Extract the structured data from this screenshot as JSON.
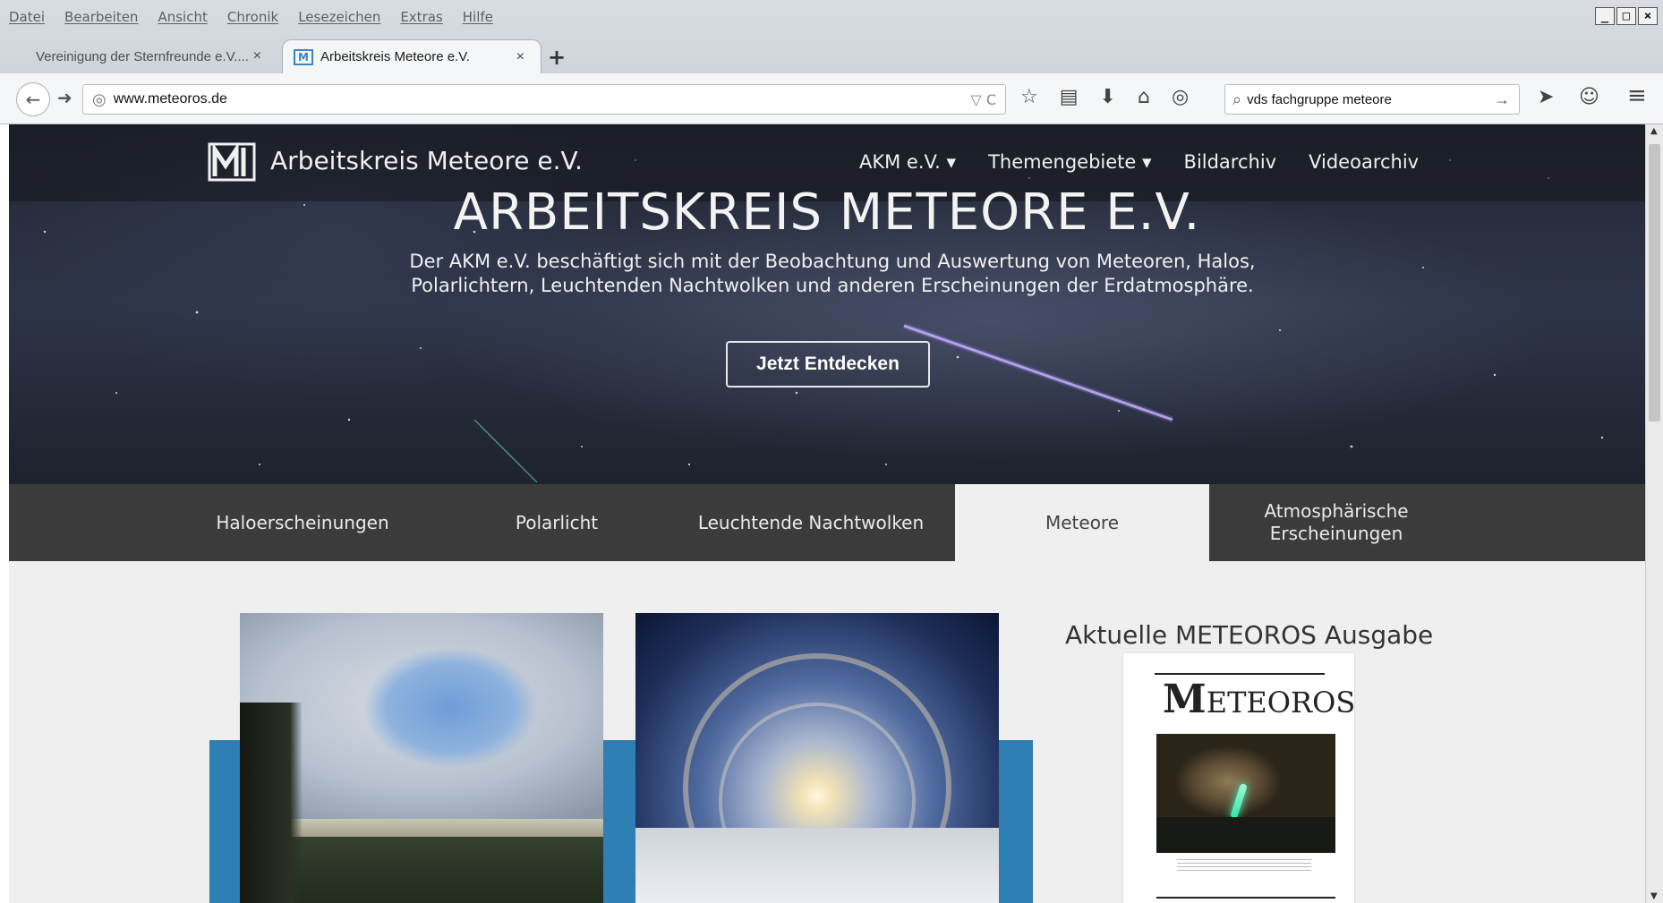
{
  "menubar": [
    "Datei",
    "Bearbeiten",
    "Ansicht",
    "Chronik",
    "Lesezeichen",
    "Extras",
    "Hilfe"
  ],
  "window_controls": [
    "_",
    "□",
    "×"
  ],
  "tabs": [
    {
      "label": "Vereinigung der Sternfreunde e.V....",
      "close": "×"
    },
    {
      "label": "Arbeitskreis Meteore e.V.",
      "close": "×",
      "favicon": "M"
    }
  ],
  "new_tab": "+",
  "address_bar": {
    "url": "www.meteoros.de",
    "right": "▽ C"
  },
  "search_bar": {
    "value": "vds fachgruppe meteore"
  },
  "toolbar_icons": [
    "☆",
    "▤",
    "⬇",
    "⌂",
    "◎"
  ],
  "toolbar_right": [
    "➤",
    "☺",
    "≡"
  ],
  "site": {
    "name": "Arbeitskreis Meteore e.V.",
    "nav": [
      "AKM e.V. ▾",
      "Themengebiete ▾",
      "Bildarchiv",
      "Videoarchiv"
    ],
    "hero_title": "ARBEITSKREIS METEORE E.V.",
    "hero_desc": "Der AKM e.V. beschäftigt sich mit der Beobachtung und Auswertung von Meteoren, Halos, Polarlichtern, Leuchtenden Nachtwolken und anderen Erscheinungen der Erdatmosphäre.",
    "cta": "Jetzt Entdecken",
    "topics": [
      "Haloerscheinungen",
      "Polarlicht",
      "Leuchtende Nachtwolken",
      "Meteore",
      "Atmosphärische Erscheinungen"
    ],
    "active_topic": "Meteore",
    "meteoros_title": "Aktuelle METEOROS Ausgabe",
    "cover_title_m": "M",
    "cover_title_rest": "ETEOROS"
  },
  "colors": {
    "accent_blue": "#2e7fb3",
    "topic_bar": "#3b3b3b"
  }
}
